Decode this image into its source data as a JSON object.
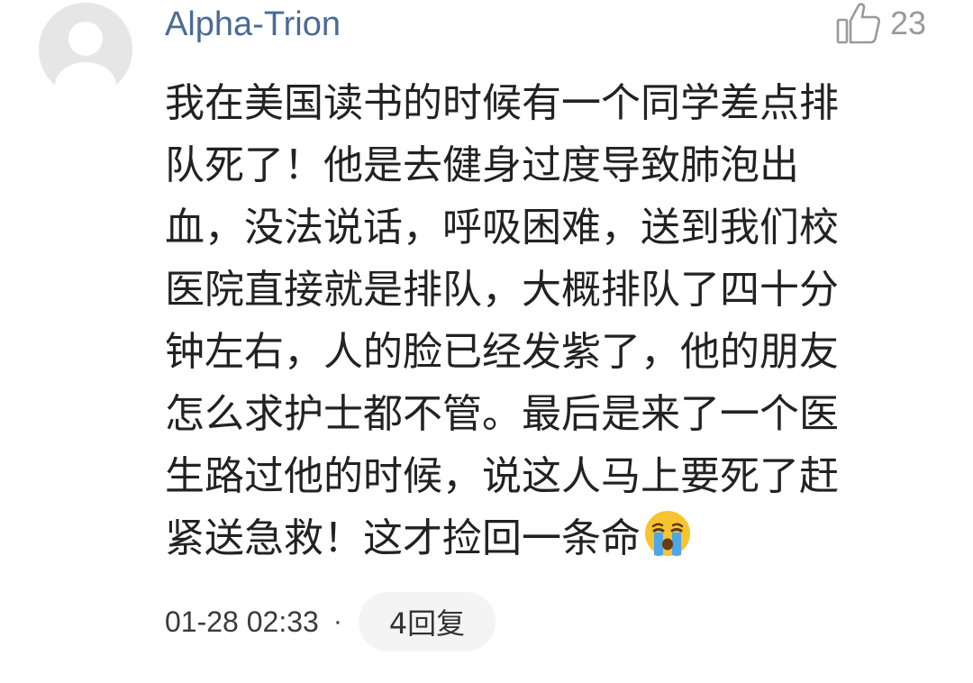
{
  "comment": {
    "username": "Alpha-Trion",
    "likes": "23",
    "body_lines": [
      "我在美国读书的时候有一个同学差点排",
      "队死了！他是去健身过度导致肺泡出",
      "血，没法说话，呼吸困难，送到我们校",
      "医院直接就是排队，大概排队了四十分",
      "钟左右，人的脸已经发紫了，他的朋友",
      "怎么求护士都不管。最后是来了一个医",
      "生路过他的时候，说这人马上要死了赶",
      "紧送急救！这才捡回一条命"
    ],
    "emoji": "crying-face-emoji",
    "date": "01-28 02:33",
    "separator": "·",
    "reply_label": "4回复"
  },
  "icons": {
    "avatar": "default-avatar-icon",
    "like": "thumbs-up-icon"
  },
  "colors": {
    "username": "#4a6b94",
    "body_text": "#222222",
    "meta_text": "#3a3a3a",
    "like_gray": "#9a9a9a",
    "pill_bg": "#f4f4f4",
    "avatar_bg": "#e8e8e8"
  }
}
